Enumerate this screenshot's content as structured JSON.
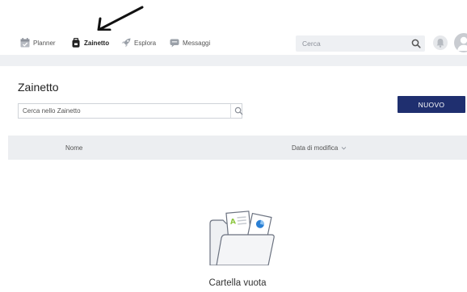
{
  "nav": {
    "items": [
      {
        "label": "Planner",
        "icon": "planner-icon"
      },
      {
        "label": "Zainetto",
        "icon": "backpack-icon",
        "active": true
      },
      {
        "label": "Esplora",
        "icon": "rocket-icon"
      },
      {
        "label": "Messaggi",
        "icon": "chat-icon"
      }
    ],
    "search_placeholder": "Cerca"
  },
  "page": {
    "title": "Zainetto",
    "search_placeholder": "Cerca nello Zainetto",
    "new_button": "NUOVO"
  },
  "table": {
    "columns": [
      "Nome",
      "Data di modifica"
    ]
  },
  "empty_state": {
    "text": "Cartella vuota"
  },
  "colors": {
    "primary": "#1f2f6f",
    "header_bg": "#eceef1",
    "accent_green": "#8cc63f",
    "accent_blue": "#2a7fd4"
  }
}
